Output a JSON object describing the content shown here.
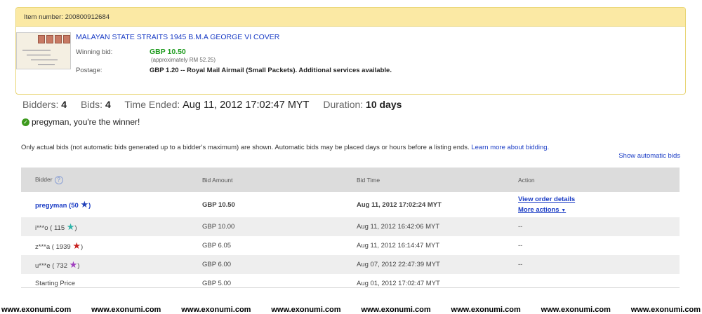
{
  "item": {
    "number_label": "Item number: 200800912684",
    "title": "MALAYAN STATE STRAITS 1945 B.M.A GEORGE VI COVER",
    "winning_bid_label": "Winning bid:",
    "winning_bid": "GBP 10.50",
    "approx": "(approximately RM 52.25)",
    "postage_label": "Postage:",
    "postage": "GBP 1.20 -- Royal Mail Airmail (Small Packets).  Additional services available."
  },
  "stats": {
    "bidders_label": "Bidders:",
    "bidders": "4",
    "bids_label": "Bids:",
    "bids": "4",
    "time_label": "Time Ended:",
    "time": "Aug 11, 2012 17:02:47 MYT",
    "duration_label": "Duration:",
    "duration": "10 days"
  },
  "winner_text": "pregyman, you're the winner!",
  "info": {
    "text": "Only actual bids (not automatic bids generated up to a bidder's maximum) are shown. Automatic bids may be placed days or hours before a listing ends.",
    "link": "Learn more about bidding.",
    "show_auto": "Show automatic bids"
  },
  "table": {
    "headers": [
      "Bidder",
      "Bid Amount",
      "Bid Time",
      "Action"
    ],
    "help_glyph": "?",
    "rows": [
      {
        "bidder": "pregyman",
        "score": "50",
        "star_color": "#1f3fb8",
        "amount": "GBP 10.50",
        "time": "Aug 11, 2012 17:02:24 MYT",
        "action1": "View order details",
        "action2": "More actions"
      },
      {
        "bidder": "i***o",
        "score": "115",
        "star_color": "#2bb3a8",
        "amount": "GBP 10.00",
        "time": "Aug 11, 2012 16:42:06 MYT",
        "action1": "--"
      },
      {
        "bidder": "z***a",
        "score": "1939",
        "star_color": "#c8201e",
        "amount": "GBP 6.05",
        "time": "Aug 11, 2012 16:14:47 MYT",
        "action1": "--"
      },
      {
        "bidder": "u***e",
        "score": "732",
        "star_color": "#a03fbf",
        "amount": "GBP 6.00",
        "time": "Aug 07, 2012 22:47:39 MYT",
        "action1": "--"
      },
      {
        "bidder": "Starting Price",
        "amount": "GBP 5.00",
        "time": "Aug 01, 2012 17:02:47 MYT"
      }
    ]
  },
  "watermark": "www.exonumi.com"
}
